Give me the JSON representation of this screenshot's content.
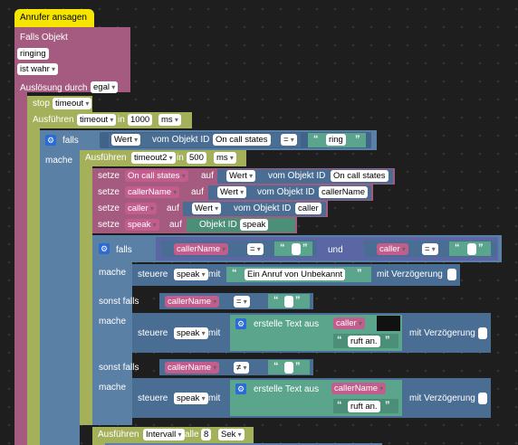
{
  "header": {
    "title": "Anrufer ansagen"
  },
  "trigger": {
    "falls_objekt": "Falls Objekt",
    "object_value": "ringing",
    "condition": "ist wahr",
    "ausloesung_label": "Auslösung durch",
    "ausloesung_value": "egal"
  },
  "stop": {
    "label": "stop",
    "timeout_value": "timeout"
  },
  "timeout1": {
    "label": "Ausführen",
    "name": "timeout",
    "in": "in",
    "ms_value": "1000",
    "unit": "ms"
  },
  "if1": {
    "falls": "falls",
    "mache": "mache",
    "wert": "Wert",
    "vom_objekt": "vom Objekt ID",
    "object": "On call states",
    "op": "=",
    "text": "ring"
  },
  "timeout2": {
    "label": "Ausführen",
    "name": "timeout2",
    "in": "in",
    "ms_value": "500",
    "unit": "ms"
  },
  "sets": [
    {
      "setze": "setze",
      "var": "On call states",
      "auf": "auf",
      "wert": "Wert",
      "vom": "vom Objekt ID",
      "obj": "On call states"
    },
    {
      "setze": "setze",
      "var": "callerName",
      "auf": "auf",
      "wert": "Wert",
      "vom": "vom Objekt ID",
      "obj": "callerName"
    },
    {
      "setze": "setze",
      "var": "caller",
      "auf": "auf",
      "wert": "Wert",
      "vom": "vom Objekt ID",
      "obj": "caller"
    },
    {
      "setze": "setze",
      "var": "speak",
      "auf": "auf",
      "obj_label": "Objekt ID",
      "obj": "speak"
    }
  ],
  "if2": {
    "falls": "falls",
    "mache": "mache",
    "var1": "callerName",
    "op1": "=",
    "und": "und",
    "var2": "caller",
    "op2": "=",
    "steuere": "steuere",
    "speak": "speak",
    "mit": "mit",
    "text": "Ein Anruf von Unbekannt",
    "verz": "mit Verzögerung"
  },
  "elif1": {
    "sonst_falls": "sonst falls",
    "mache": "mache",
    "var": "callerName",
    "op": "=",
    "steuere": "steuere",
    "speak": "speak",
    "mit": "mit",
    "erstelle": "erstelle Text aus",
    "item1": "caller",
    "item2": "ruft an.",
    "verz": "mit Verzögerung"
  },
  "elif2": {
    "sonst_falls": "sonst falls",
    "mache": "mache",
    "var": "callerName",
    "op": "≠",
    "steuere": "steuere",
    "speak": "speak",
    "mit": "mit",
    "erstelle": "erstelle Text aus",
    "item1": "callerName",
    "item2": "ruft an.",
    "verz": "mit Verzögerung"
  },
  "interval": {
    "label": "Ausführen",
    "name": "Intervall",
    "alle": "alle",
    "value": "8",
    "unit": "Sek"
  }
}
